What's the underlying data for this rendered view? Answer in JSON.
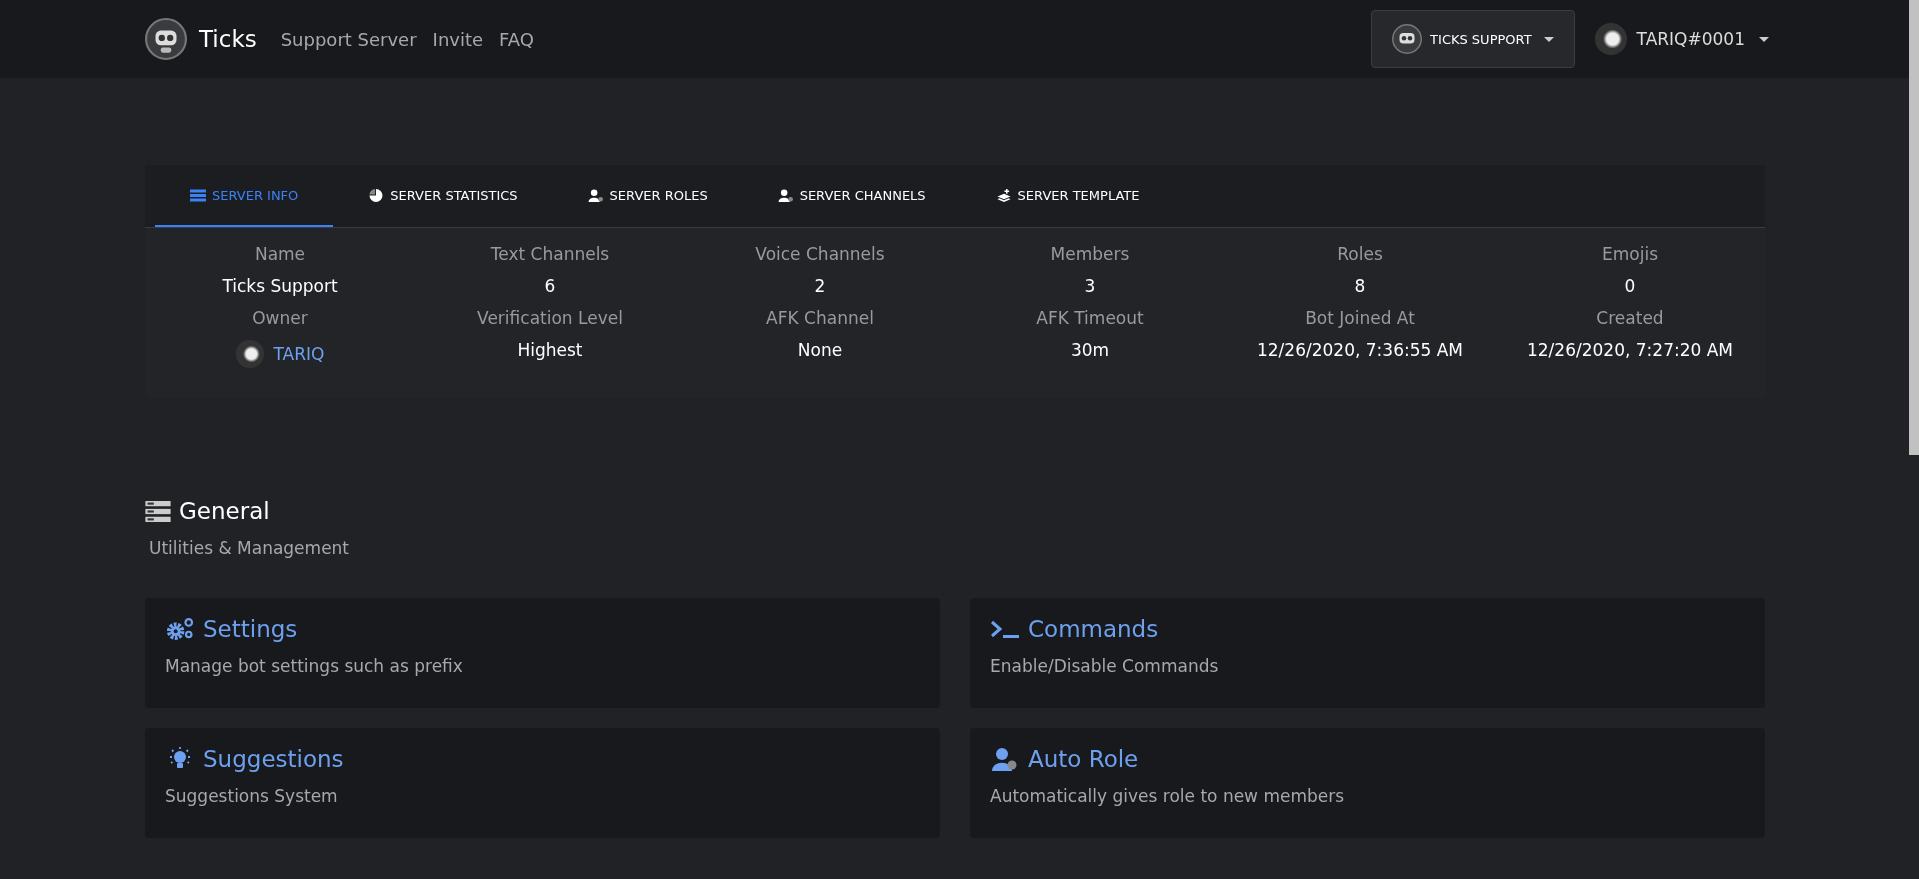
{
  "navbar": {
    "brand": "Ticks",
    "links": [
      "Support Server",
      "Invite",
      "FAQ"
    ],
    "server_button": "TICKS SUPPORT",
    "user_menu": "TARIQ#0001"
  },
  "tabs": [
    {
      "label": "SERVER INFO",
      "selected": true
    },
    {
      "label": "SERVER STATISTICS",
      "selected": false
    },
    {
      "label": "SERVER ROLES",
      "selected": false
    },
    {
      "label": "SERVER CHANNELS",
      "selected": false
    },
    {
      "label": "SERVER TEMPLATE",
      "selected": false
    }
  ],
  "server_info": [
    {
      "label": "Name",
      "value": "Ticks Support",
      "kind": "text"
    },
    {
      "label": "Text Channels",
      "value": "6",
      "kind": "text"
    },
    {
      "label": "Voice Channels",
      "value": "2",
      "kind": "text"
    },
    {
      "label": "Members",
      "value": "3",
      "kind": "text"
    },
    {
      "label": "Roles",
      "value": "8",
      "kind": "text"
    },
    {
      "label": "Emojis",
      "value": "0",
      "kind": "text"
    },
    {
      "label": "Owner",
      "value": "TARIQ",
      "kind": "user"
    },
    {
      "label": "Verification Level",
      "value": "Highest",
      "kind": "text"
    },
    {
      "label": "AFK Channel",
      "value": "None",
      "kind": "text"
    },
    {
      "label": "AFK Timeout",
      "value": "30m",
      "kind": "text"
    },
    {
      "label": "Bot Joined At",
      "value": "12/26/2020, 7:36:55 AM",
      "kind": "text"
    },
    {
      "label": "Created",
      "value": "12/26/2020, 7:27:20 AM",
      "kind": "text"
    }
  ],
  "section": {
    "title": "General",
    "subtitle": "Utilities & Management"
  },
  "modules": [
    {
      "title": "Settings",
      "description": "Manage bot settings such as prefix"
    },
    {
      "title": "Commands",
      "description": "Enable/Disable Commands"
    },
    {
      "title": "Suggestions",
      "description": "Suggestions System"
    },
    {
      "title": "Auto Role",
      "description": "Automatically gives role to new members"
    }
  ]
}
